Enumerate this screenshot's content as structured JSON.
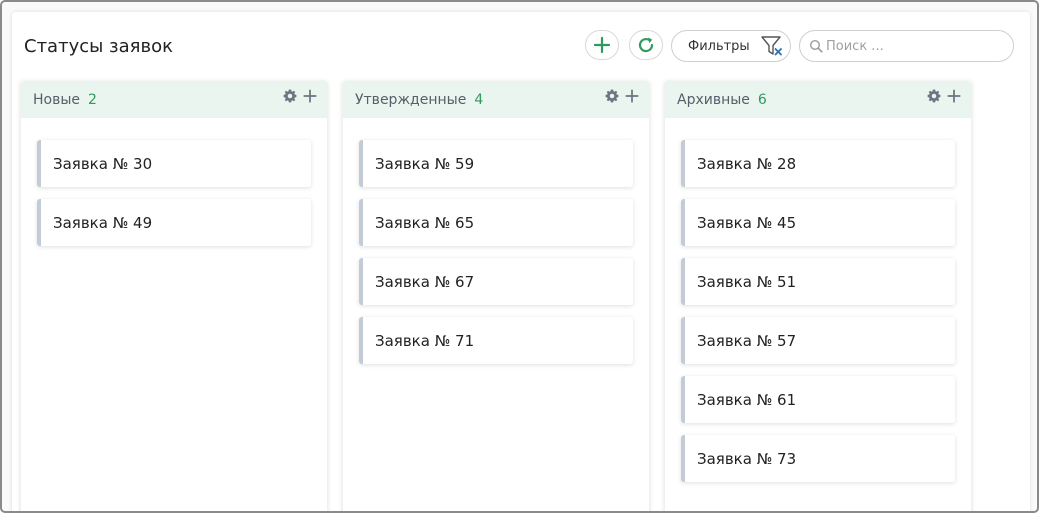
{
  "page": {
    "title": "Статусы заявок"
  },
  "toolbar": {
    "add_icon": "plus-icon",
    "refresh_icon": "refresh-icon",
    "filter_label": "Фильтры",
    "filter_icon": "filter-clear-icon",
    "search_placeholder": "Поиск ..."
  },
  "colors": {
    "accent": "#2e9a5e",
    "header_bg": "#e9f5ee",
    "card_border": "#c3ccd6"
  },
  "columns": [
    {
      "name": "Новые",
      "count": "2",
      "cards": [
        "Заявка № 30",
        "Заявка № 49"
      ]
    },
    {
      "name": "Утвержденные",
      "count": "4",
      "cards": [
        "Заявка № 59",
        "Заявка № 65",
        "Заявка № 67",
        "Заявка № 71"
      ]
    },
    {
      "name": "Архивные",
      "count": "6",
      "cards": [
        "Заявка № 28",
        "Заявка № 45",
        "Заявка № 51",
        "Заявка № 57",
        "Заявка № 61",
        "Заявка № 73"
      ]
    }
  ]
}
